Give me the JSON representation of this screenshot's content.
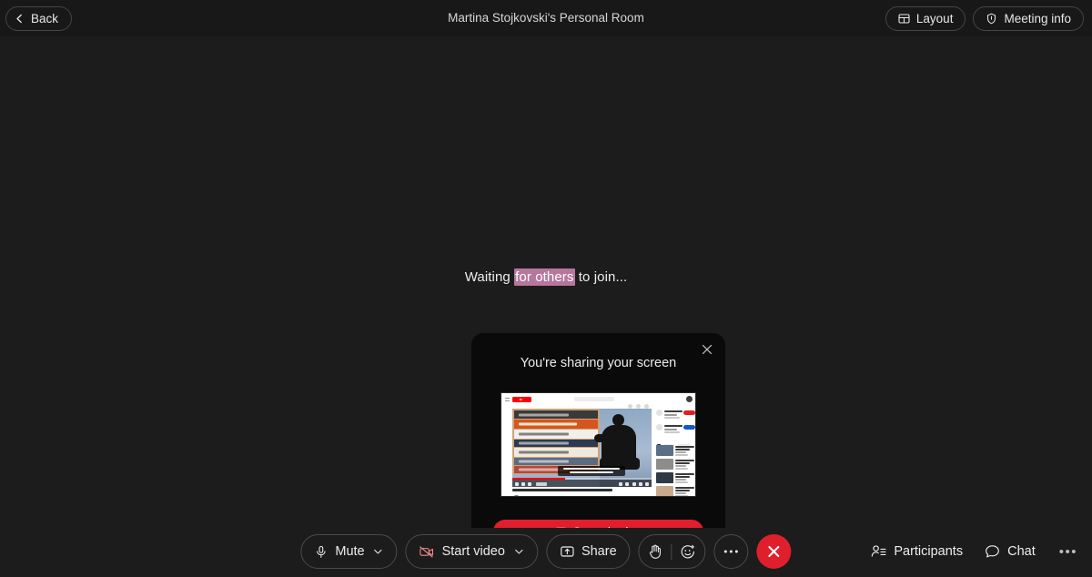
{
  "header": {
    "back_label": "Back",
    "back_icon": "chevron-left-icon",
    "title": "Martina Stojkovski's Personal Room",
    "layout_label": "Layout",
    "layout_icon": "grid-layout-icon",
    "meeting_info_label": "Meeting info",
    "meeting_info_icon": "shield-icon"
  },
  "stage": {
    "waiting_prefix": "Waiting ",
    "waiting_selected": "for others",
    "waiting_suffix": " to join...",
    "selection_color": "#b5779b"
  },
  "popup": {
    "title": "You're sharing your screen",
    "close_icon": "close-icon",
    "stop_label": "Stop sharing",
    "stop_icon": "share-screen-icon",
    "stop_color": "#e01f2d",
    "preview_name": "shared-screen-preview"
  },
  "toolbar": {
    "mute_label": "Mute",
    "mute_icon": "microphone-icon",
    "mute_chevron": "chevron-down-icon",
    "video_label": "Start video",
    "video_icon": "camera-off-icon",
    "video_chevron": "chevron-down-icon",
    "share_label": "Share",
    "share_icon": "share-screen-icon",
    "hand_icon": "raise-hand-icon",
    "reaction_icon": "reaction-smiley-icon",
    "more_icon": "more-dots-icon",
    "leave_icon": "close-icon",
    "participants_label": "Participants",
    "participants_icon": "participants-icon",
    "chat_label": "Chat",
    "chat_icon": "chat-bubble-icon",
    "overflow_icon": "more-dots-icon",
    "overflow_label": "•••"
  }
}
